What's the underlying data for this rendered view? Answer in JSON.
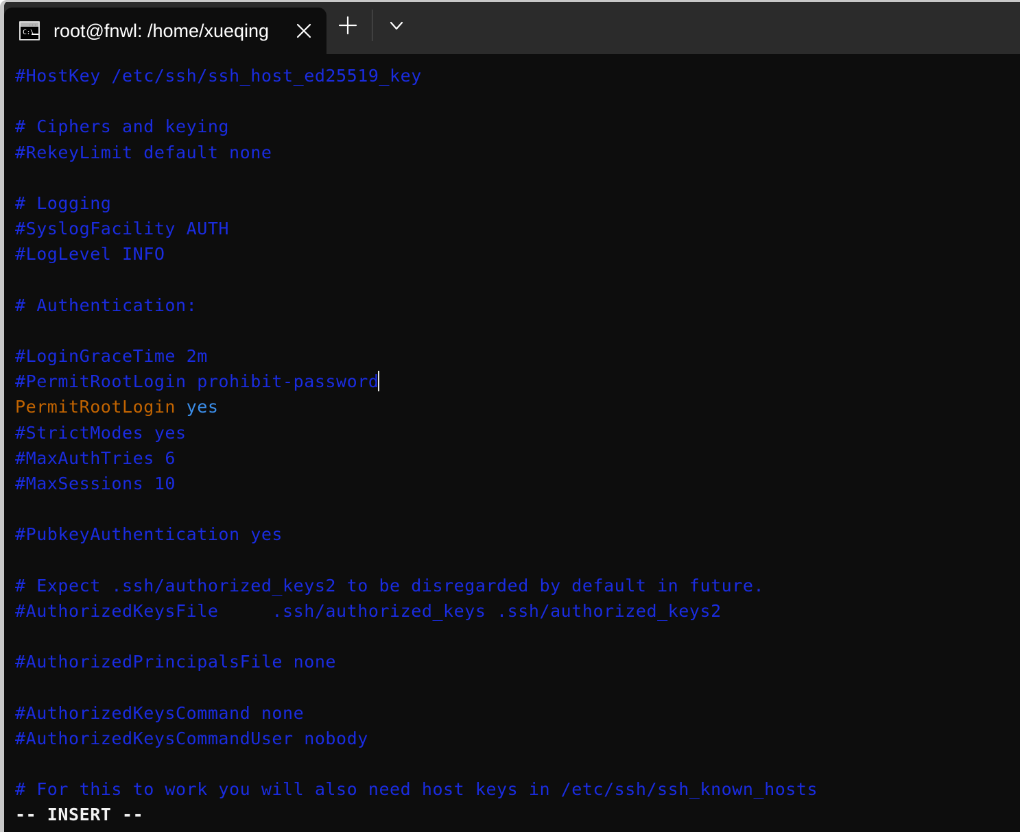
{
  "window": {
    "border_color": "#c8c8c8",
    "titlebar_bg": "#2b2b2b",
    "terminal_bg": "#0d0d0d"
  },
  "titlebar": {
    "tab": {
      "title": "root@fnwl: /home/xueqing",
      "icon_name": "console-icon",
      "icon_prompt": "C:\\",
      "close_label": "✕"
    },
    "new_tab_label": "+",
    "dropdown_label": "⌄"
  },
  "terminal": {
    "colors": {
      "comment": "#1a2ce0",
      "keyword": "#c26401",
      "value": "#3b8eea",
      "status": "#f2f2f2",
      "cursor": "#e8e8e8"
    },
    "cursor": {
      "line_index": 11,
      "column": 35
    },
    "status_line": "-- INSERT --",
    "lines": [
      {
        "i": 0,
        "text": "#HostKey /etc/ssh/ssh_host_ed25519_key",
        "style": "comment"
      },
      {
        "i": 1,
        "text": "",
        "style": "blank"
      },
      {
        "i": 2,
        "text": "# Ciphers and keying",
        "style": "comment"
      },
      {
        "i": 3,
        "text": "#RekeyLimit default none",
        "style": "comment"
      },
      {
        "i": 4,
        "text": "",
        "style": "blank"
      },
      {
        "i": 5,
        "text": "# Logging",
        "style": "comment"
      },
      {
        "i": 6,
        "text": "#SyslogFacility AUTH",
        "style": "comment"
      },
      {
        "i": 7,
        "text": "#LogLevel INFO",
        "style": "comment"
      },
      {
        "i": 8,
        "text": "",
        "style": "blank"
      },
      {
        "i": 9,
        "text": "# Authentication:",
        "style": "comment"
      },
      {
        "i": 10,
        "text": "",
        "style": "blank"
      },
      {
        "i": 11,
        "text": "#LoginGraceTime 2m",
        "style": "comment"
      },
      {
        "i": 12,
        "text": "#PermitRootLogin prohibit-password",
        "style": "comment",
        "cursor_after": true
      },
      {
        "i": 13,
        "text": "PermitRootLogin yes",
        "style": "directive",
        "keyword": "PermitRootLogin",
        "value": "yes"
      },
      {
        "i": 14,
        "text": "#StrictModes yes",
        "style": "comment"
      },
      {
        "i": 15,
        "text": "#MaxAuthTries 6",
        "style": "comment"
      },
      {
        "i": 16,
        "text": "#MaxSessions 10",
        "style": "comment"
      },
      {
        "i": 17,
        "text": "",
        "style": "blank"
      },
      {
        "i": 18,
        "text": "#PubkeyAuthentication yes",
        "style": "comment"
      },
      {
        "i": 19,
        "text": "",
        "style": "blank"
      },
      {
        "i": 20,
        "text": "# Expect .ssh/authorized_keys2 to be disregarded by default in future.",
        "style": "comment"
      },
      {
        "i": 21,
        "text": "#AuthorizedKeysFile     .ssh/authorized_keys .ssh/authorized_keys2",
        "style": "comment"
      },
      {
        "i": 22,
        "text": "",
        "style": "blank"
      },
      {
        "i": 23,
        "text": "#AuthorizedPrincipalsFile none",
        "style": "comment"
      },
      {
        "i": 24,
        "text": "",
        "style": "blank"
      },
      {
        "i": 25,
        "text": "#AuthorizedKeysCommand none",
        "style": "comment"
      },
      {
        "i": 26,
        "text": "#AuthorizedKeysCommandUser nobody",
        "style": "comment"
      },
      {
        "i": 27,
        "text": "",
        "style": "blank"
      },
      {
        "i": 28,
        "text": "# For this to work you will also need host keys in /etc/ssh/ssh_known_hosts",
        "style": "comment"
      }
    ]
  }
}
